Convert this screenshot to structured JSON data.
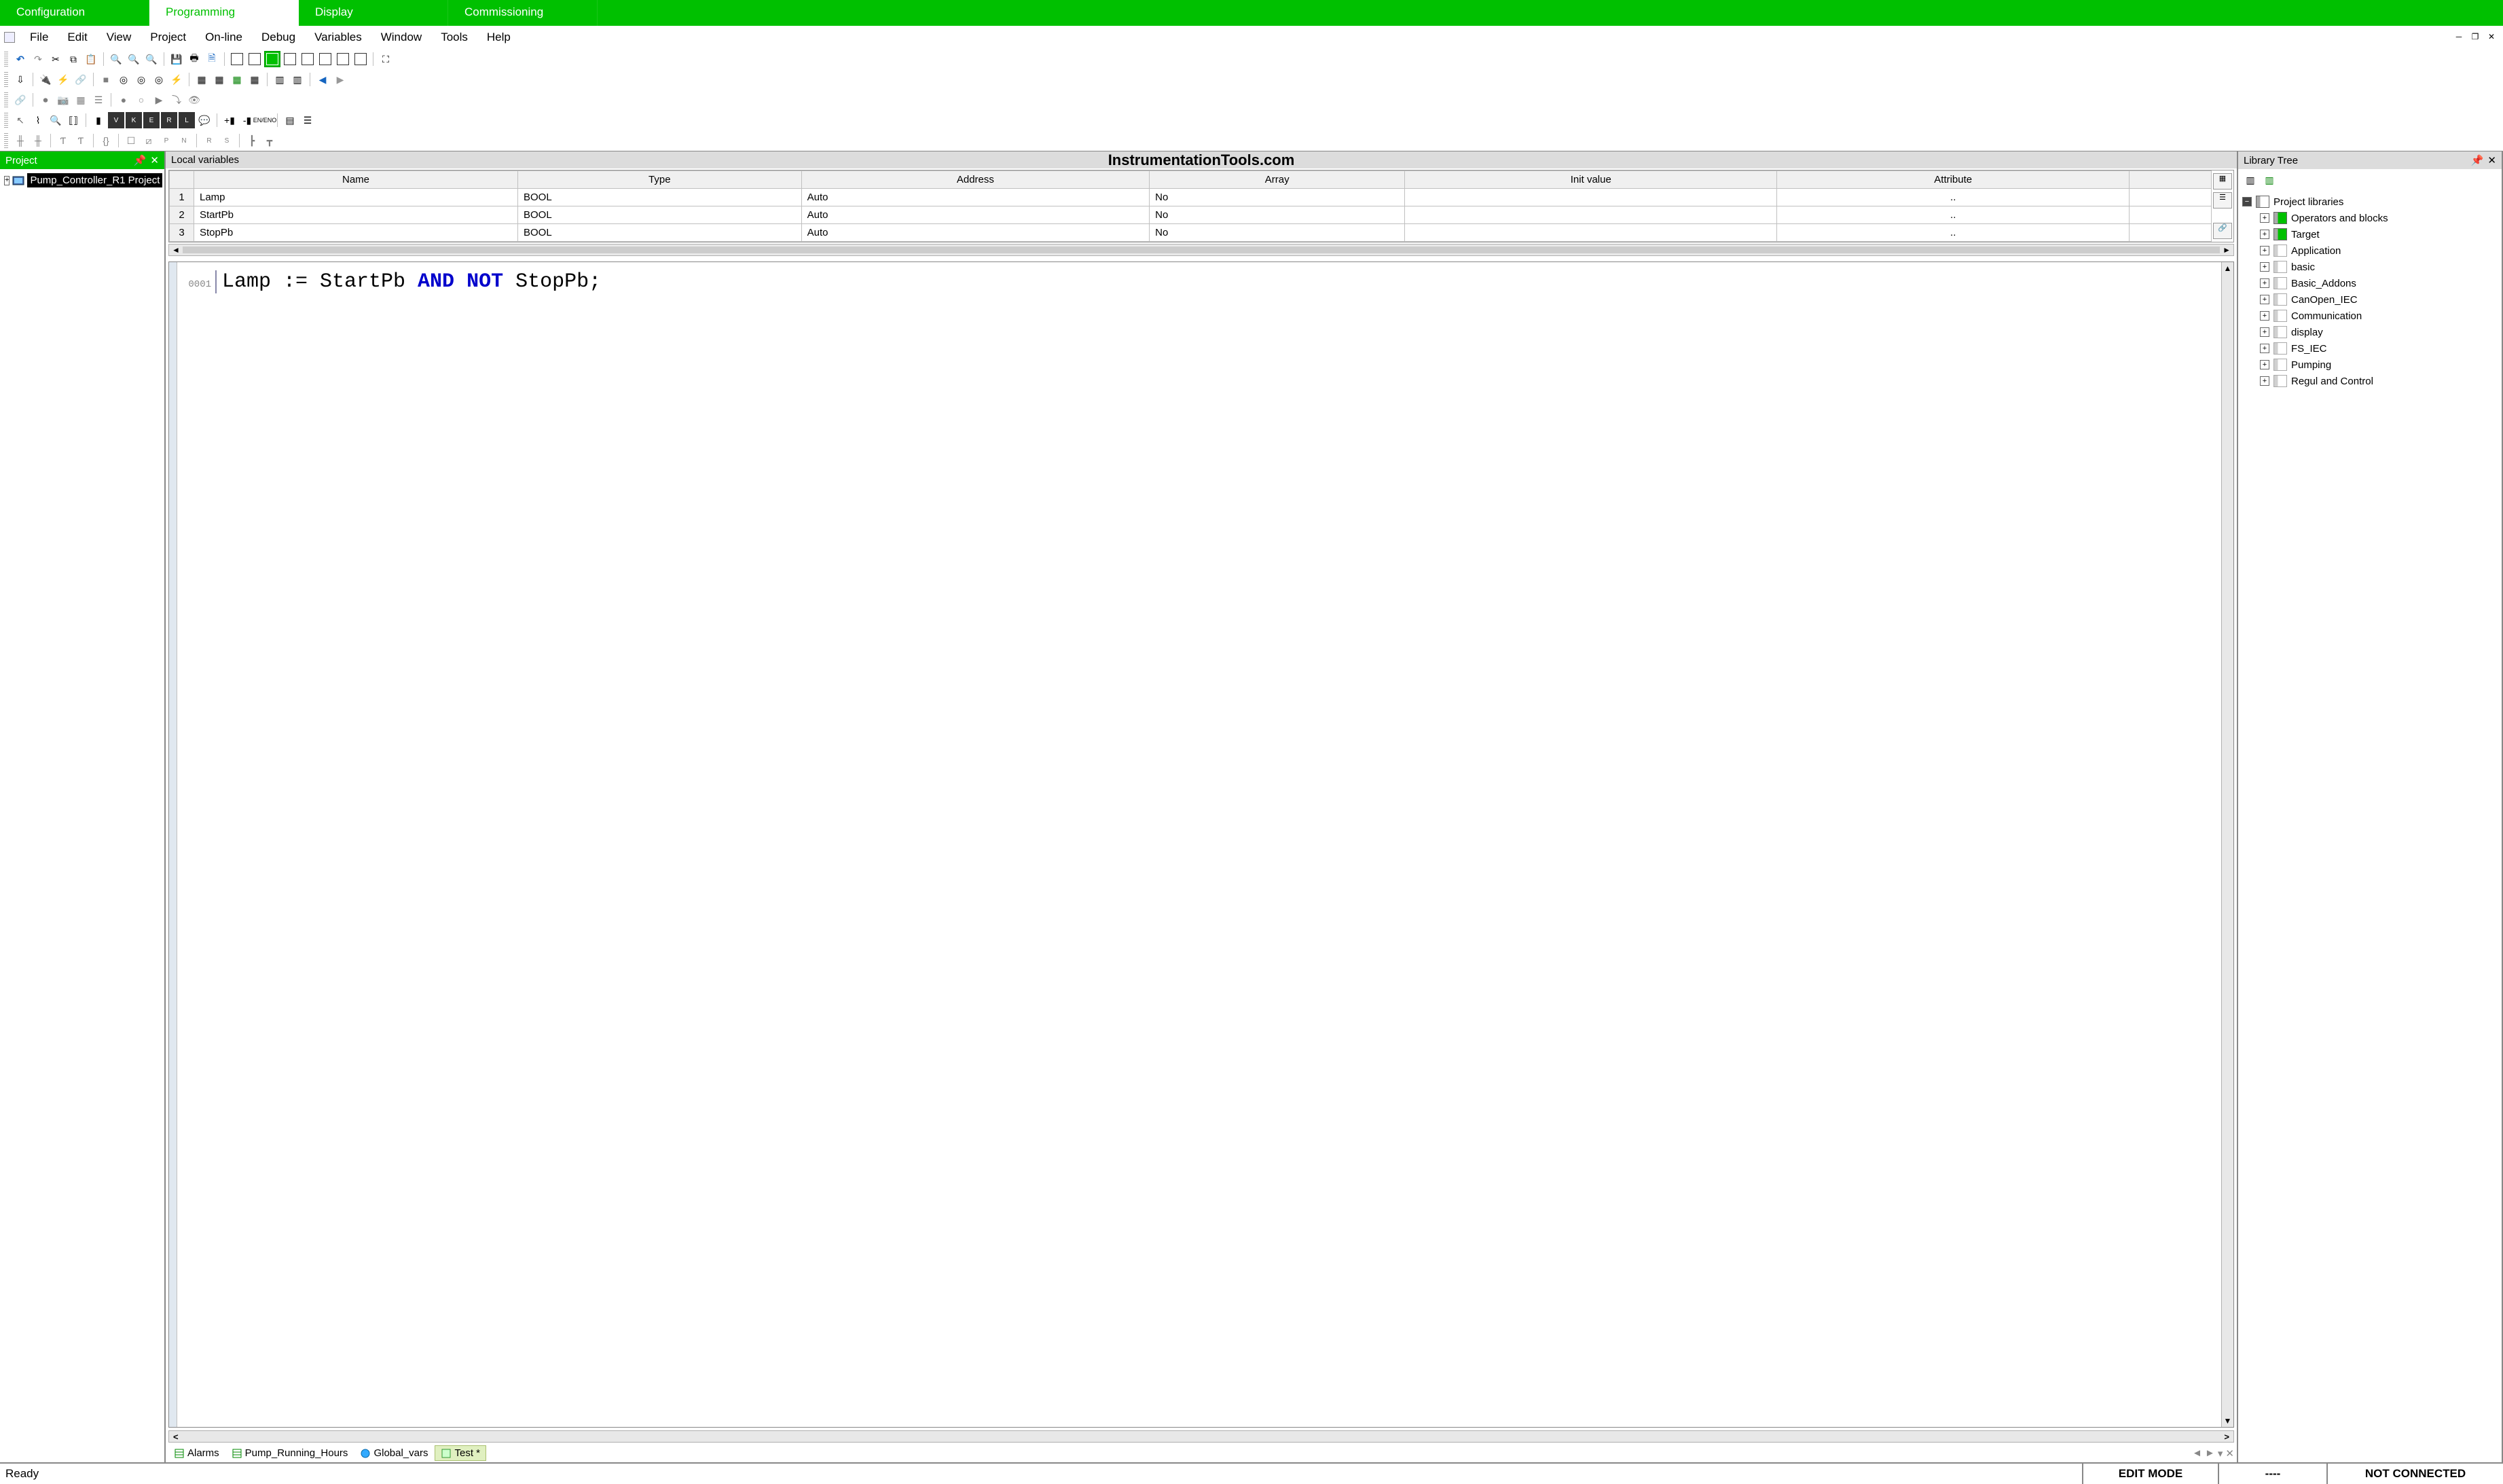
{
  "topTabs": {
    "configuration": "Configuration",
    "programming": "Programming",
    "display": "Display",
    "commissioning": "Commissioning"
  },
  "menu": {
    "file": "File",
    "edit": "Edit",
    "view": "View",
    "project": "Project",
    "online": "On-line",
    "debug": "Debug",
    "variables": "Variables",
    "window": "Window",
    "tools": "Tools",
    "help": "Help"
  },
  "projectPanel": {
    "title": "Project",
    "rootLabel": "Pump_Controller_R1 Project"
  },
  "localVars": {
    "title": "Local variables",
    "watermark": "InstrumentationTools.com",
    "headers": {
      "name": "Name",
      "type": "Type",
      "address": "Address",
      "array": "Array",
      "initValue": "Init value",
      "attribute": "Attribute"
    },
    "rows": [
      {
        "num": "1",
        "name": "Lamp",
        "type": "BOOL",
        "address": "Auto",
        "array": "No",
        "init": "",
        "attr": ".."
      },
      {
        "num": "2",
        "name": "StartPb",
        "type": "BOOL",
        "address": "Auto",
        "array": "No",
        "init": "",
        "attr": ".."
      },
      {
        "num": "3",
        "name": "StopPb",
        "type": "BOOL",
        "address": "Auto",
        "array": "No",
        "init": "",
        "attr": ".."
      }
    ]
  },
  "code": {
    "lineNumber": "0001",
    "p1": "Lamp := StartPb ",
    "kw1": "AND",
    "sp": " ",
    "kw2": "NOT",
    "p2": " StopPb;"
  },
  "editorTabs": {
    "alarms": "Alarms",
    "pumpHours": "Pump_Running_Hours",
    "globals": "Global_vars",
    "test": "Test *"
  },
  "libraryPanel": {
    "title": "Library Tree",
    "root": "Project libraries",
    "items": [
      "Operators and blocks",
      "Target",
      "Application",
      "basic",
      "Basic_Addons",
      "CanOpen_IEC",
      "Communication",
      "display",
      "FS_IEC",
      "Pumping",
      "Regul and Control"
    ]
  },
  "statusBar": {
    "ready": "Ready",
    "mode": "EDIT MODE",
    "middle": "----",
    "conn": "NOT CONNECTED"
  }
}
